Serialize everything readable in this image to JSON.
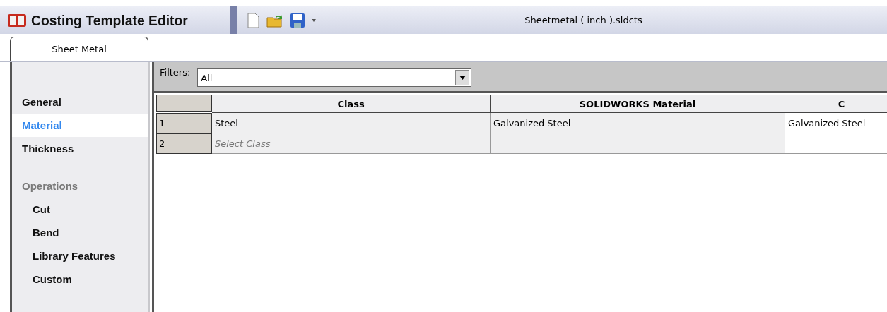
{
  "window": {
    "title": "Costing Template Editor",
    "file": "Sheetmetal ( inch ).sldcts"
  },
  "tabs": [
    {
      "label": "Sheet Metal",
      "selected": true
    }
  ],
  "sidebar": {
    "items": [
      {
        "kind": "item",
        "label": "General",
        "selected": false
      },
      {
        "kind": "item",
        "label": "Material",
        "selected": true
      },
      {
        "kind": "item",
        "label": "Thickness",
        "selected": false
      },
      {
        "kind": "header",
        "label": "Operations",
        "children": [
          {
            "label": "Cut",
            "selected": false
          },
          {
            "label": "Bend",
            "selected": false
          },
          {
            "label": "Library Features",
            "selected": false
          },
          {
            "label": "Custom",
            "selected": false
          }
        ]
      }
    ]
  },
  "filters": {
    "label": "Filters:",
    "value": "All"
  },
  "table": {
    "columns": [
      "Class",
      "SOLIDWORKS Material",
      "C"
    ],
    "rows": [
      {
        "number": "1",
        "cells": [
          {
            "text": "Steel"
          },
          {
            "text": "Galvanized Steel"
          },
          {
            "text": "Galvanized Steel"
          }
        ]
      },
      {
        "number": "2",
        "cells": [
          {
            "placeholder": "Select Class"
          },
          {},
          {}
        ]
      }
    ]
  }
}
